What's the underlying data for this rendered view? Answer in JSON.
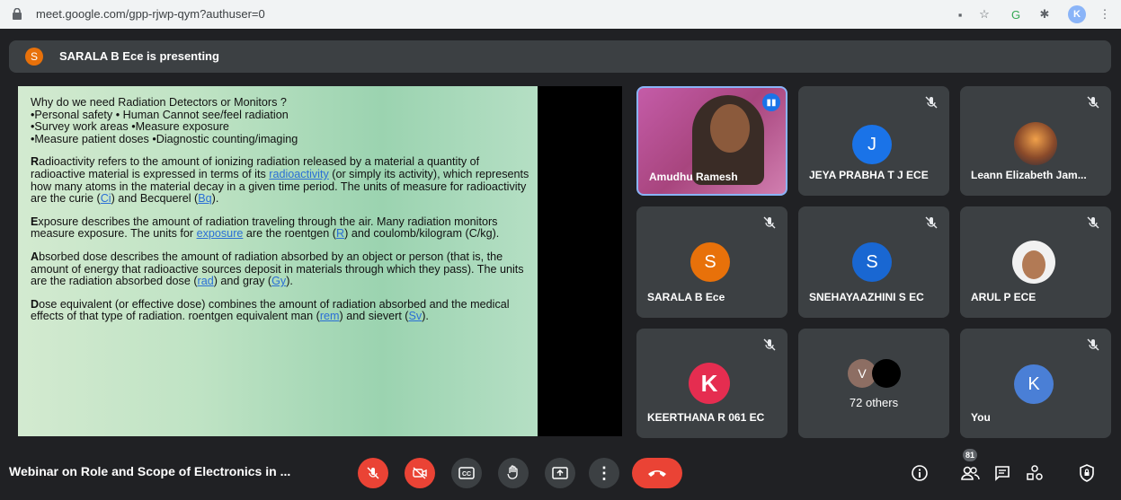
{
  "browser": {
    "url": "meet.google.com/gpp-rjwp-qym?authuser=0",
    "profile_initial": "K"
  },
  "presenting": {
    "initial": "S",
    "text": "SARALA B Ece is presenting"
  },
  "slide": {
    "heading": "Why do we need Radiation Detectors or Monitors ?",
    "bullets": [
      "•Personal safety   • Human Cannot see/feel radiation",
      "•Survey work areas   •Measure exposure",
      "•Measure patient doses  •Diagnostic counting/imaging"
    ],
    "p1": {
      "lead": "R",
      "a": "adioactivity refers to the amount of ionizing radiation released by a material a quantity of radioactive material is expressed in terms of its ",
      "l1": "radioactivity",
      "b": " (or simply its activity), which represents how many atoms in the material decay in a given time period. The units of measure for radioactivity are the curie (",
      "l2": "Ci",
      "c": ") and Becquerel (",
      "l3": "Bq",
      "d": ")."
    },
    "p2": {
      "lead": "E",
      "a": "xposure describes the amount of radiation traveling through the air. Many radiation monitors measure exposure. The units for ",
      "l1": "exposure",
      "b": " are the roentgen (",
      "l2": "R",
      "c": ") and coulomb/kilogram (C/kg)."
    },
    "p3": {
      "lead": "A",
      "a": "bsorbed dose describes the amount of radiation absorbed by an object or person (that is, the amount of energy that radioactive sources deposit in materials through which they pass). The units are the radiation absorbed dose (",
      "l1": "rad",
      "b": ") and gray (",
      "l2": "Gy",
      "c": ")."
    },
    "p4": {
      "lead": "D",
      "a": "ose equivalent (or effective dose) combines the amount of radiation absorbed and the medical effects of that type of radiation.  roentgen equivalent man (",
      "l1": "rem",
      "b": ") and sievert (",
      "l2": "Sv",
      "c": ")."
    }
  },
  "participants": [
    {
      "name": "Amudhu Ramesh"
    },
    {
      "name": "JEYA PRABHA T J ECE",
      "initial": "J",
      "color": "#1a73e8"
    },
    {
      "name": "Leann Elizabeth Jam..."
    },
    {
      "name": "SARALA B Ece",
      "initial": "S",
      "color": "#e8710a"
    },
    {
      "name": "SNEHAYAAZHINI S EC",
      "initial": "S",
      "color": "#1967d2"
    },
    {
      "name": "ARUL P ECE"
    },
    {
      "name": "KEERTHANA R 061 EC",
      "initial": "K",
      "color": "#e52d50"
    },
    {
      "others": "72 others",
      "initial": "V"
    },
    {
      "name": "You",
      "initial": "K",
      "color": "#4a7fd6"
    }
  ],
  "bottom": {
    "title": "Webinar on Role and Scope of Electronics in ...",
    "people_count": "81"
  }
}
